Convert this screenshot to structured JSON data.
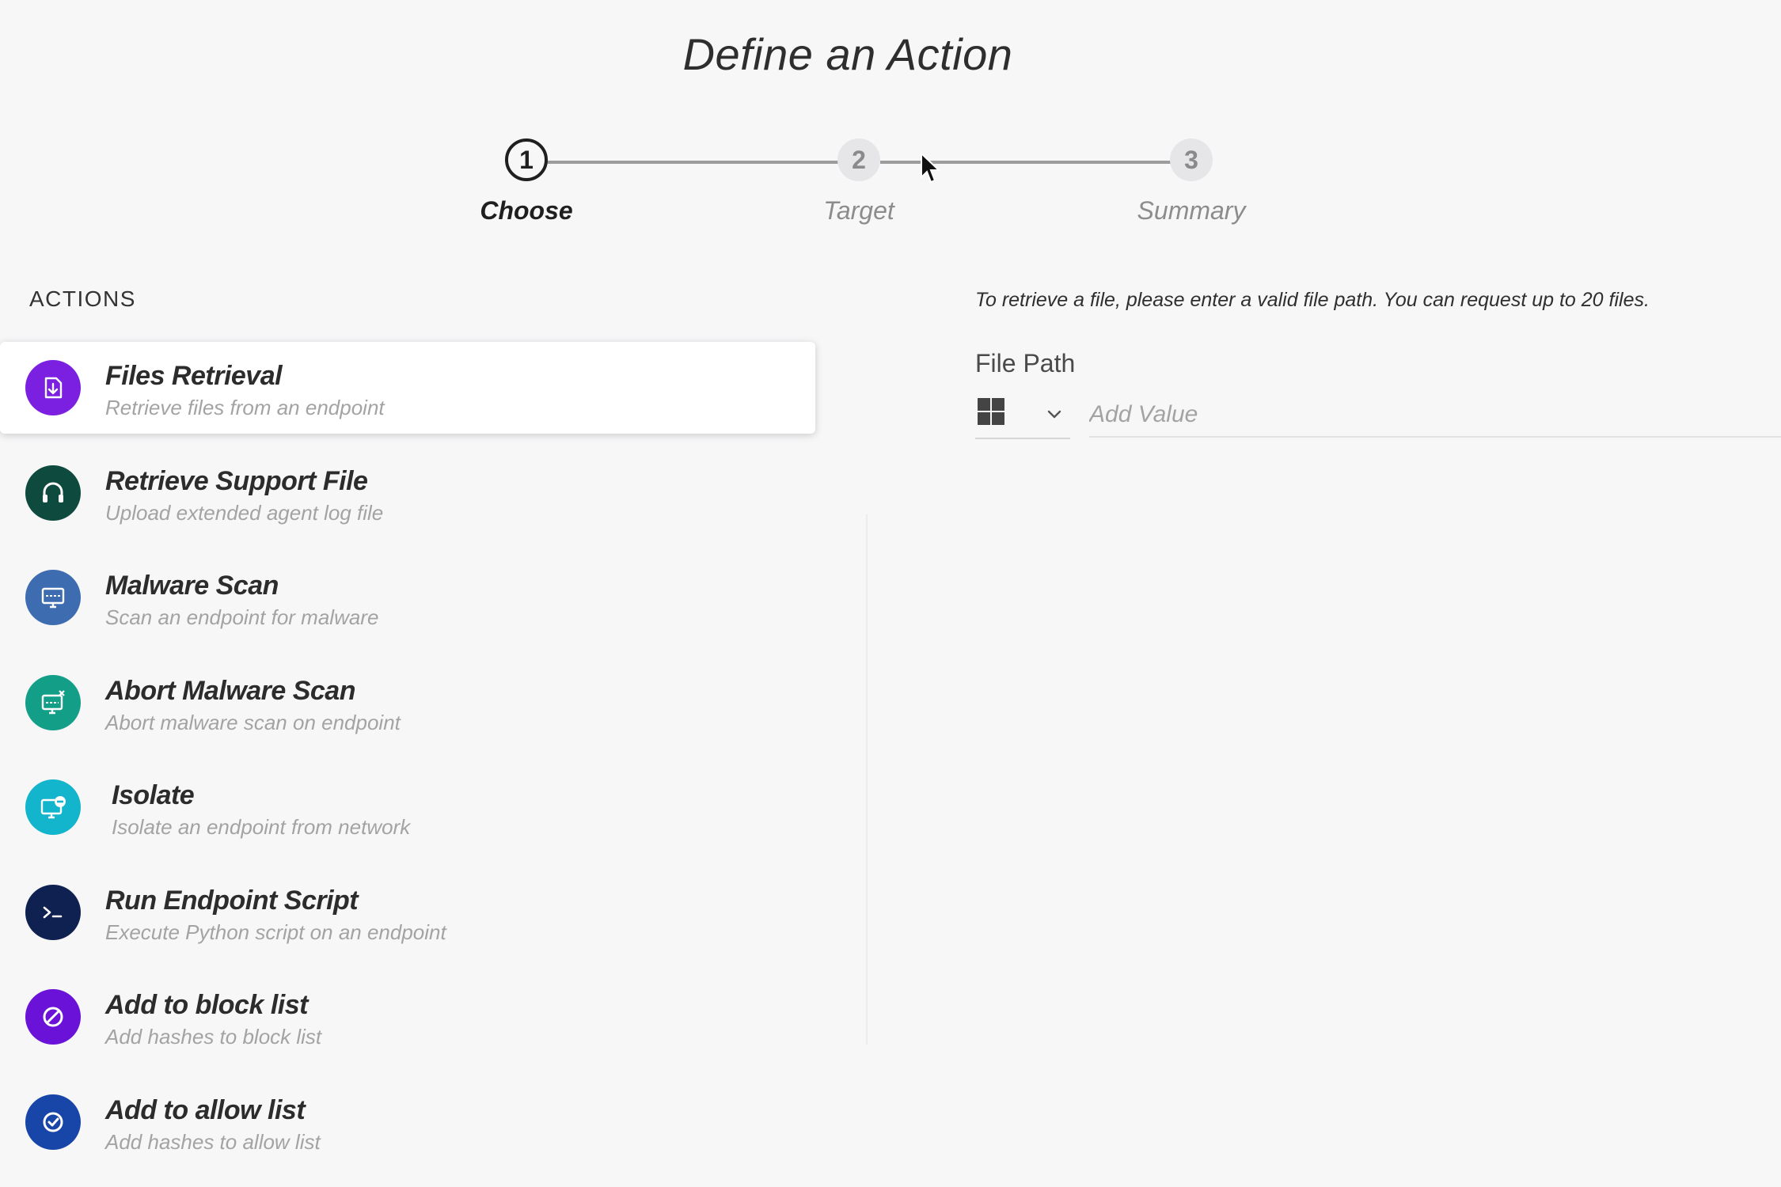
{
  "page": {
    "title": "Define an Action"
  },
  "stepper": {
    "steps": [
      {
        "number": "1",
        "label": "Choose",
        "state": "active"
      },
      {
        "number": "2",
        "label": "Target",
        "state": "inactive"
      },
      {
        "number": "3",
        "label": "Summary",
        "state": "inactive"
      }
    ]
  },
  "actions": {
    "heading": "ACTIONS",
    "items": [
      {
        "title": "Files Retrieval",
        "description": "Retrieve files from an endpoint",
        "icon": "file-download-icon",
        "color": "#7b1fe0",
        "selected": true
      },
      {
        "title": "Retrieve Support File",
        "description": "Upload extended agent log file",
        "icon": "headset-icon",
        "color": "#0e4a3e",
        "selected": false
      },
      {
        "title": "Malware Scan",
        "description": "Scan an endpoint for malware",
        "icon": "monitor-scan-icon",
        "color": "#3e6cb0",
        "selected": false
      },
      {
        "title": "Abort Malware Scan",
        "description": "Abort malware scan on endpoint",
        "icon": "monitor-abort-icon",
        "color": "#139e88",
        "selected": false
      },
      {
        "title": "Isolate",
        "description": "Isolate an endpoint from network",
        "icon": "monitor-isolate-icon",
        "color": "#12b5cc",
        "selected": false
      },
      {
        "title": "Run Endpoint Script",
        "description": "Execute Python script on an endpoint",
        "icon": "terminal-icon",
        "color": "#0f2150",
        "selected": false
      },
      {
        "title": "Add to block list",
        "description": "Add hashes to block list",
        "icon": "block-icon",
        "color": "#6a12d8",
        "selected": false
      },
      {
        "title": "Add to allow list",
        "description": "Add hashes to allow list",
        "icon": "check-circle-icon",
        "color": "#1846a8",
        "selected": false
      }
    ]
  },
  "panel": {
    "instructions": "To retrieve a file, please enter a valid file path. You can request up to 20 files.",
    "file_path_label": "File Path",
    "os_selected": "windows-icon",
    "value_placeholder": "Add Value",
    "value": ""
  }
}
